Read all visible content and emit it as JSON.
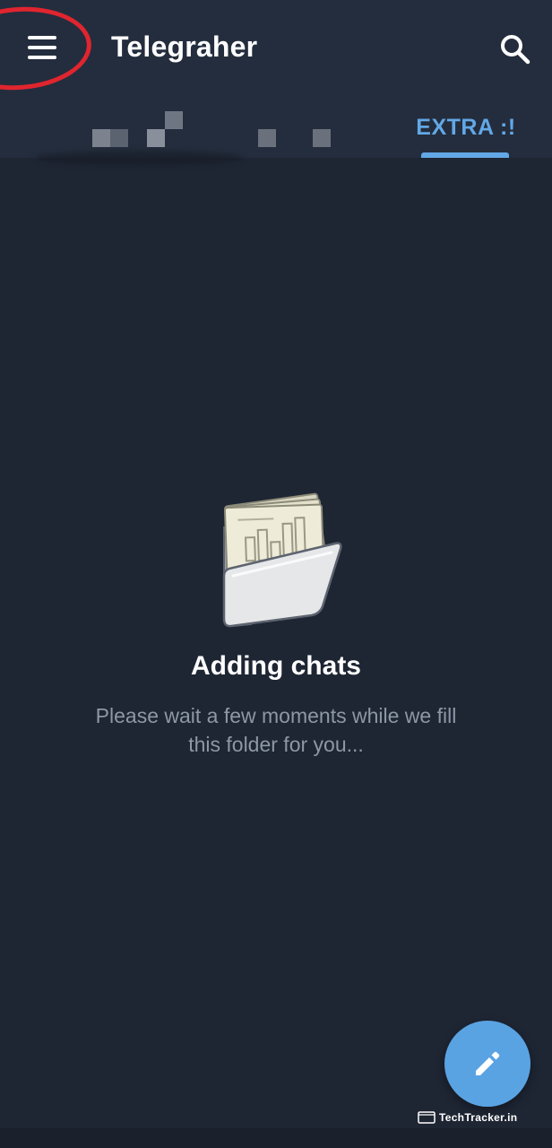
{
  "app_bar": {
    "menu_icon": "hamburger-menu-icon",
    "title": "Telegraher",
    "search_icon": "search-icon",
    "background": "#242d3d"
  },
  "tabs": [
    {
      "label": "",
      "blurred": true,
      "selected": false
    },
    {
      "label": "EXTRA :!",
      "selected": true
    }
  ],
  "empty_state": {
    "illustration": "folder-with-chats-icon",
    "title": "Adding chats",
    "subtitle": "Please wait a few moments while we fill this folder for you..."
  },
  "fab": {
    "icon": "pencil-icon",
    "color": "#5aa3e3"
  },
  "watermark": {
    "text": "TechTracker.in"
  },
  "colors": {
    "background": "#1e2533",
    "accent": "#62a8e6",
    "annotation_ring": "#e0252f",
    "subtitle_text": "#8e97a5"
  }
}
